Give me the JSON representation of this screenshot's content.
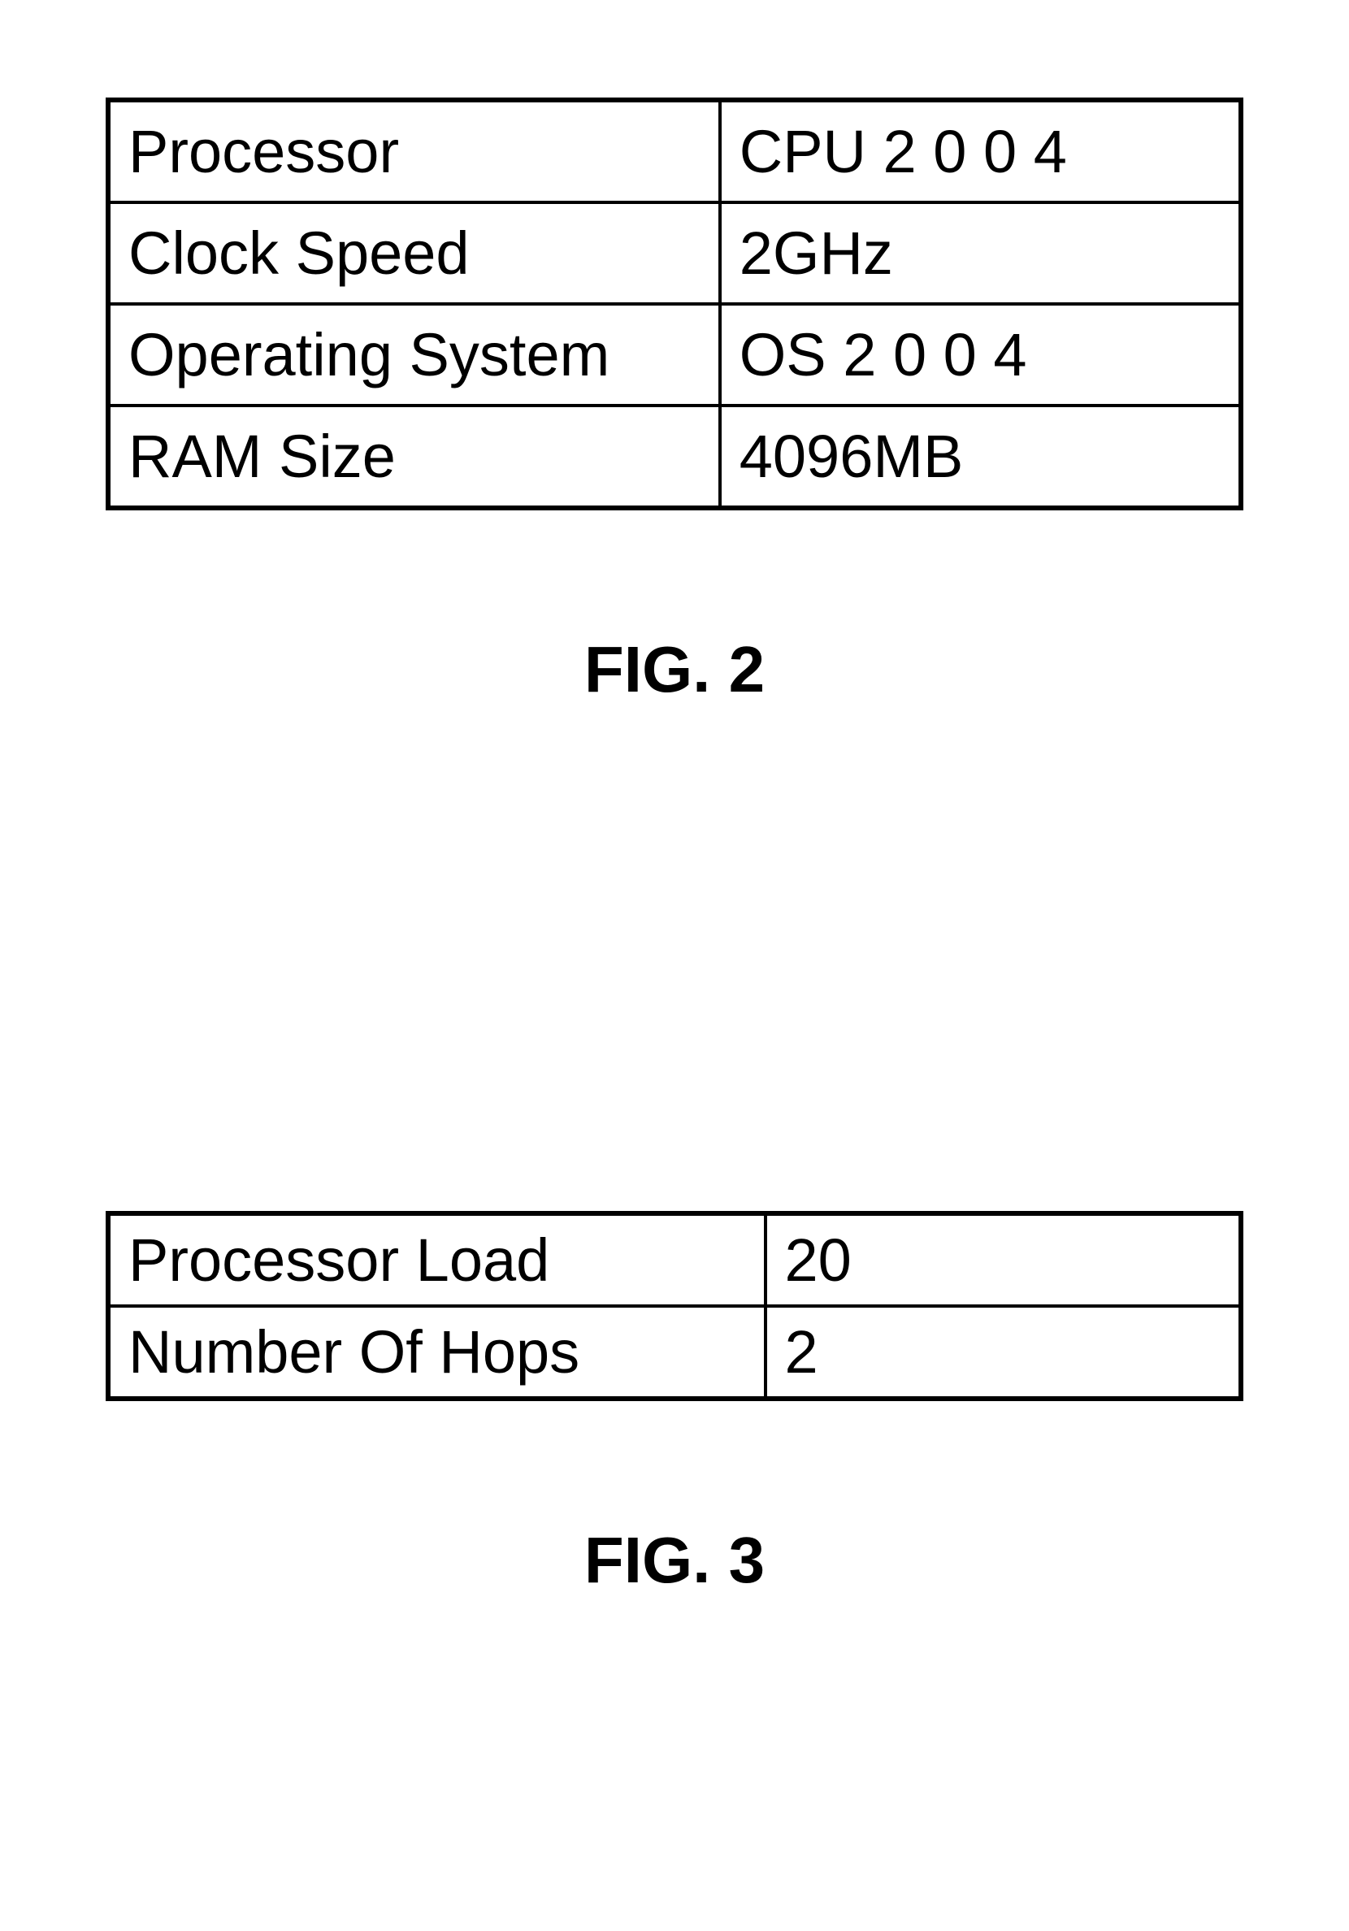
{
  "figure2": {
    "caption": "FIG. 2",
    "rows": [
      {
        "label": "Processor",
        "value": "CPU 2 0 0 4"
      },
      {
        "label": "Clock Speed",
        "value": "2GHz"
      },
      {
        "label": "Operating System",
        "value": "OS 2 0 0 4"
      },
      {
        "label": "RAM Size",
        "value": "4096MB"
      }
    ]
  },
  "figure3": {
    "caption": "FIG. 3",
    "rows": [
      {
        "label": "Processor Load",
        "value": "20"
      },
      {
        "label": "Number Of Hops",
        "value": "2"
      }
    ]
  }
}
